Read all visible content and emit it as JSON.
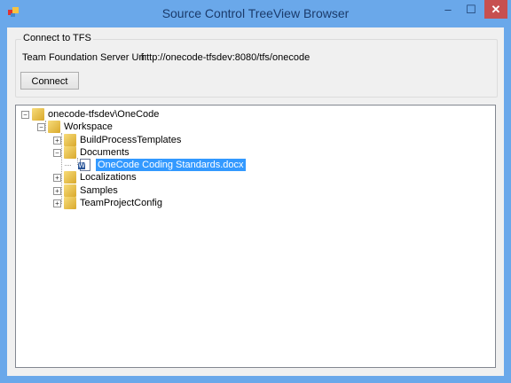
{
  "window": {
    "title": "Source Control TreeView Browser",
    "minimize": "–",
    "maximize": "☐",
    "close": "✕",
    "accent": "#6aa8ea"
  },
  "group": {
    "label": "Connect to TFS",
    "server_label": "Team Foundation Server Uri:",
    "server_value": "http://onecode-tfsdev:8080/tfs/onecode",
    "connect": "Connect"
  },
  "tree": {
    "nodes": [
      {
        "label": "onecode-tfsdev\\OneCode",
        "level": 0,
        "expander": "−",
        "icon": "folder-icon"
      },
      {
        "label": "Workspace",
        "level": 1,
        "expander": "−",
        "icon": "folder-icon"
      },
      {
        "label": "BuildProcessTemplates",
        "level": 2,
        "expander": "+",
        "icon": "folder-icon"
      },
      {
        "label": "Documents",
        "level": 2,
        "expander": "−",
        "icon": "folder-icon"
      },
      {
        "label": "OneCode Coding Standards.docx",
        "level": 3,
        "expander": "",
        "icon": "word-document-icon",
        "selected": true
      },
      {
        "label": "Localizations",
        "level": 2,
        "expander": "+",
        "icon": "folder-icon"
      },
      {
        "label": "Samples",
        "level": 2,
        "expander": "+",
        "icon": "folder-icon"
      },
      {
        "label": "TeamProjectConfig",
        "level": 2,
        "expander": "+",
        "icon": "folder-icon"
      }
    ]
  }
}
